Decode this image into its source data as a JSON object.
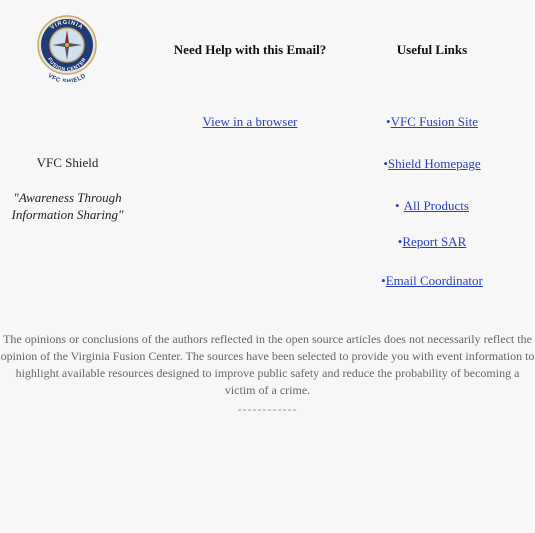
{
  "logo": {
    "arc_top": "VIRGINIA",
    "arc_bottom": "FUSION CENTER",
    "caption": "VFC SHIELD",
    "accent_color": "#1f3c73",
    "gold_color": "#c9a86b"
  },
  "left": {
    "name": "VFC Shield",
    "tagline": "\"Awareness Through Information Sharing\""
  },
  "help": {
    "title": "Need Help with this Email?",
    "browser_link": "View in a browser"
  },
  "links": {
    "title": "Useful Links",
    "bullet": "•",
    "items": [
      "VFC Fusion Site",
      "Shield Homepage",
      "All Products",
      "Report SAR",
      "Email Coordinator"
    ]
  },
  "footer": {
    "disclaimer": "The opinions or conclusions of the authors reflected in the open source articles does not necessarily reflect the opinion of the Virginia Fusion Center. The sources have been selected to provide you with event information to highlight available resources designed to improve public safety and reduce the probability of becoming a victim of a crime.",
    "divider": "------------"
  },
  "colors": {
    "link": "#2a3fbf",
    "background": "#f7f7f7"
  }
}
